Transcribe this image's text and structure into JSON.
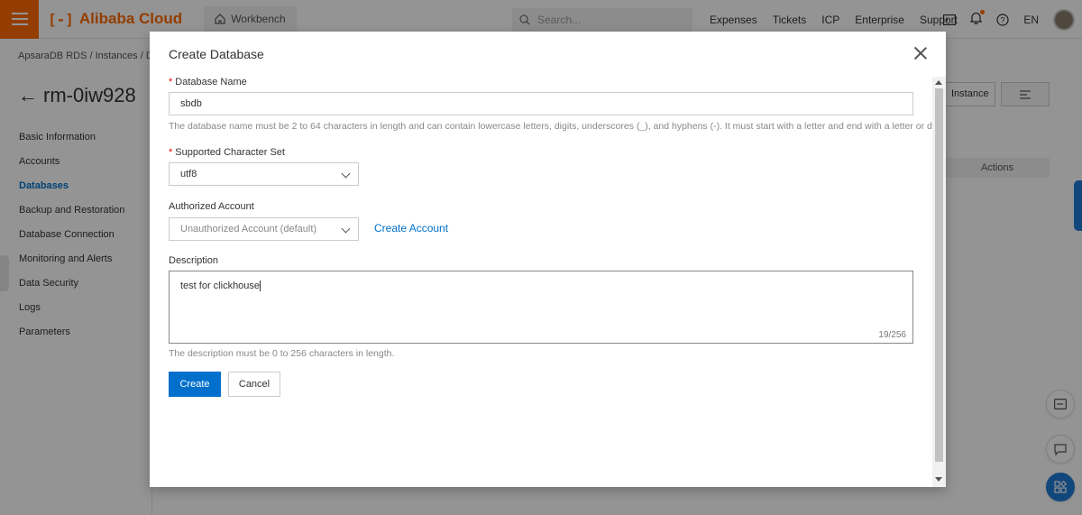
{
  "topbar": {
    "brand": "Alibaba Cloud",
    "brand_mark": "[-]",
    "workbench": "Workbench",
    "search_placeholder": "Search...",
    "links": [
      "Expenses",
      "Tickets",
      "ICP",
      "Enterprise",
      "Support"
    ],
    "language": "EN",
    "accent_color": "#ff6a00"
  },
  "background": {
    "breadcrumb": "ApsaraDB RDS  /  Instances  /  D",
    "instance_title": "rm-0iw928",
    "nav": [
      "Basic Information",
      "Accounts",
      "Databases",
      "Backup and Restoration",
      "Database Connection",
      "Monitoring and Alerts",
      "Data Security",
      "Logs",
      "Parameters"
    ],
    "active_nav": "Databases",
    "instance_btn": "Instance",
    "actions_header": "Actions"
  },
  "dialog": {
    "title": "Create Database",
    "db_name": {
      "label": "Database Name",
      "required": "*",
      "value": "sbdb",
      "help": "The database name must be 2 to 64 characters in length and can contain lowercase letters, digits, underscores (_), and hyphens (-). It must start with a letter and end with a letter or digit."
    },
    "charset": {
      "label": "Supported Character Set",
      "required": "*",
      "value": "utf8"
    },
    "account": {
      "label": "Authorized Account",
      "value": "Unauthorized Account (default)",
      "create_link": "Create Account"
    },
    "description": {
      "label": "Description",
      "value": "test for clickhouse",
      "counter": "19/256",
      "help": "The description must be 0 to 256 characters in length."
    },
    "buttons": {
      "create": "Create",
      "cancel": "Cancel"
    },
    "primary_color": "#0070cc"
  }
}
